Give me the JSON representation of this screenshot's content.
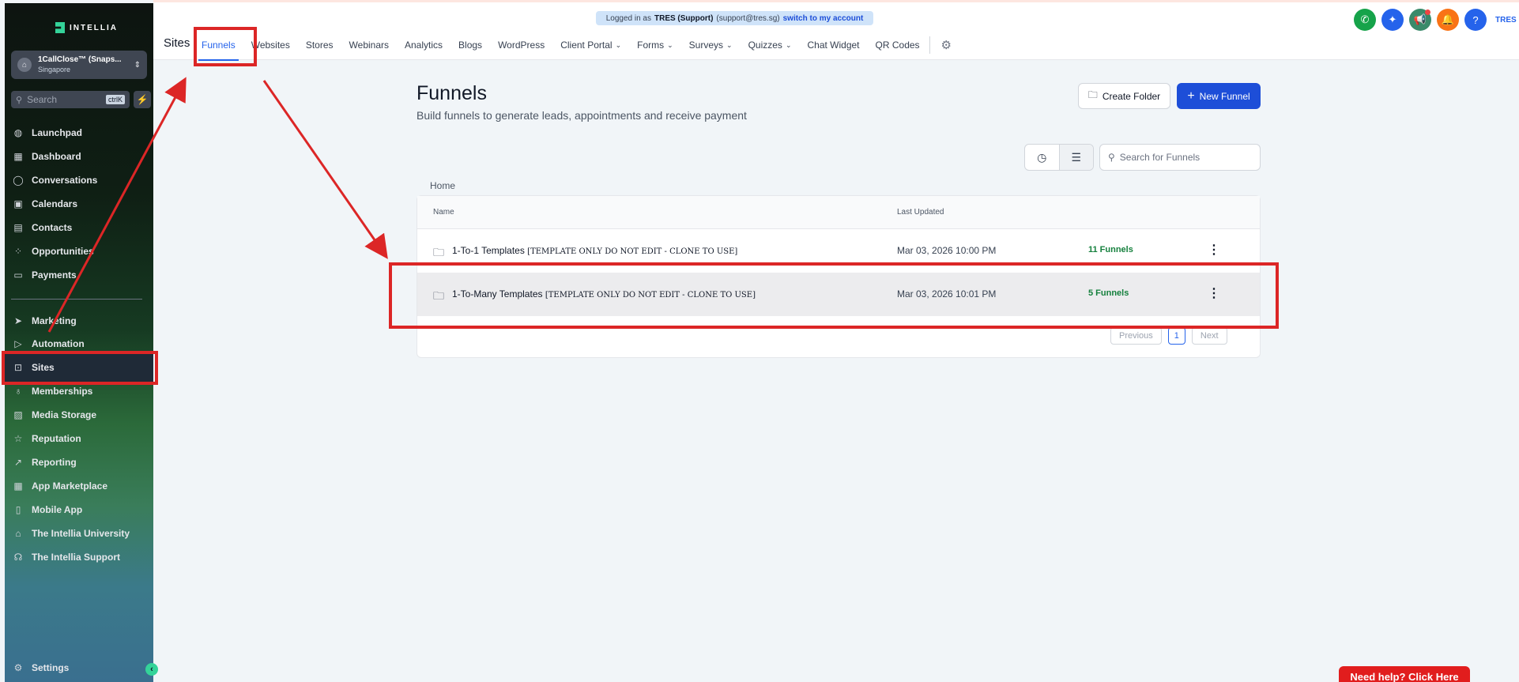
{
  "brand": {
    "name": "INTELLIA"
  },
  "account": {
    "name": "1CallClose™ (Snaps...",
    "location": "Singapore"
  },
  "sidebar": {
    "search_placeholder": "Search",
    "search_shortcut": "ctrlK",
    "items": [
      {
        "label": "Launchpad",
        "icon": "rocket-icon"
      },
      {
        "label": "Dashboard",
        "icon": "grid-icon"
      },
      {
        "label": "Conversations",
        "icon": "chat-icon"
      },
      {
        "label": "Calendars",
        "icon": "calendar-icon"
      },
      {
        "label": "Contacts",
        "icon": "contacts-icon"
      },
      {
        "label": "Opportunities",
        "icon": "network-icon"
      },
      {
        "label": "Payments",
        "icon": "payments-icon"
      },
      {
        "label": "Marketing",
        "icon": "send-icon"
      },
      {
        "label": "Automation",
        "icon": "play-circle-icon"
      },
      {
        "label": "Sites",
        "icon": "globe-window-icon"
      },
      {
        "label": "Memberships",
        "icon": "badge-icon"
      },
      {
        "label": "Media Storage",
        "icon": "image-icon"
      },
      {
        "label": "Reputation",
        "icon": "star-icon"
      },
      {
        "label": "Reporting",
        "icon": "trend-icon"
      },
      {
        "label": "App Marketplace",
        "icon": "apps-icon"
      },
      {
        "label": "Mobile App",
        "icon": "phone-icon"
      },
      {
        "label": "The Intellia University",
        "icon": "graduation-cap-icon"
      },
      {
        "label": "The Intellia Support",
        "icon": "headset-icon"
      }
    ],
    "settings": "Settings",
    "active": "Sites"
  },
  "impersonation": {
    "prefix": "Logged in as",
    "user": "TRES (Support)",
    "email": "(support@tres.sg)",
    "switch": "switch to my account"
  },
  "header": {
    "title": "Sites",
    "tabs": [
      "Funnels",
      "Websites",
      "Stores",
      "Webinars",
      "Analytics",
      "Blogs",
      "WordPress",
      "Client Portal",
      "Forms",
      "Surveys",
      "Quizzes",
      "Chat Widget",
      "QR Codes"
    ],
    "active_tab": "Funnels",
    "user_initials": "TRES",
    "icon_colors": {
      "phone": "#16a34a",
      "magic": "#2563eb",
      "megaphone": "#3a8a6a",
      "bell": "#f97316",
      "help": "#2563eb"
    }
  },
  "page": {
    "title": "Funnels",
    "subtitle": "Build funnels to generate leads, appointments and receive payment",
    "create_folder": "Create Folder",
    "new_funnel": "New Funnel",
    "search_placeholder": "Search for Funnels",
    "breadcrumb": "Home"
  },
  "table": {
    "headers": {
      "name": "Name",
      "updated": "Last Updated"
    },
    "rows": [
      {
        "name": "1-To-1 Templates",
        "note": "[TEMPLATE ONLY DO NOT EDIT - CLONE TO USE]",
        "updated": "Mar 03, 2026 10:00 PM",
        "count": "11 Funnels"
      },
      {
        "name": "1-To-Many Templates",
        "note": "[TEMPLATE ONLY DO NOT EDIT - CLONE TO USE]",
        "updated": "Mar 03, 2026 10:01 PM",
        "count": "5 Funnels"
      }
    ]
  },
  "pagination": {
    "previous": "Previous",
    "current": "1",
    "next": "Next"
  },
  "help_button": "Need help? Click Here"
}
